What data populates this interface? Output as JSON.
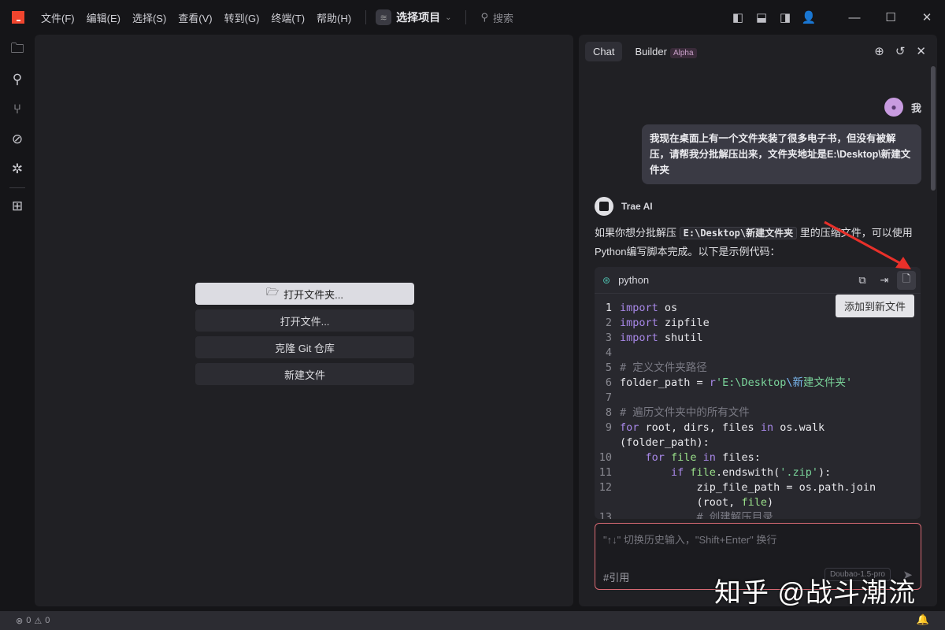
{
  "menu": [
    "文件(F)",
    "编辑(E)",
    "选择(S)",
    "查看(V)",
    "转到(G)",
    "终端(T)",
    "帮助(H)"
  ],
  "project": "选择项目",
  "search_placeholder": "搜索",
  "editor_buttons": {
    "open_folder": "打开文件夹...",
    "open_file": "打开文件...",
    "clone": "克隆 Git 仓库",
    "new_file": "新建文件"
  },
  "chat": {
    "tabs": {
      "chat": "Chat",
      "builder": "Builder",
      "alpha": "Alpha"
    },
    "user_name": "我",
    "user_message": "我现在桌面上有一个文件夹装了很多电子书，但没有被解压，请帮我分批解压出来，文件夹地址是E:\\Desktop\\新建文件夹",
    "ai_name": "Trae AI",
    "ai_text_1": "如果你想分批解压",
    "ai_inline_code": "E:\\Desktop\\新建文件夹",
    "ai_text_2": "里的压缩文件，可以使用Python编写脚本完成。以下是示例代码：",
    "code_lang": "python",
    "tooltip": "添加到新文件",
    "code_lines": [
      {
        "n": "1",
        "t": [
          [
            "kw",
            "import"
          ],
          [
            "id",
            " os"
          ]
        ]
      },
      {
        "n": "2",
        "t": [
          [
            "kw",
            "import"
          ],
          [
            "id",
            " zipfile"
          ]
        ]
      },
      {
        "n": "3",
        "t": [
          [
            "kw",
            "import"
          ],
          [
            "id",
            " shutil"
          ]
        ]
      },
      {
        "n": "4",
        "t": []
      },
      {
        "n": "5",
        "t": [
          [
            "cm",
            "# 定义文件夹路径"
          ]
        ]
      },
      {
        "n": "6",
        "t": [
          [
            "id",
            "folder_path = "
          ],
          [
            "kw",
            "r"
          ],
          [
            "st",
            "'E:\\Desktop"
          ],
          [
            "esc",
            "\\新"
          ],
          [
            "st",
            "建文件夹'"
          ]
        ]
      },
      {
        "n": "7",
        "t": []
      },
      {
        "n": "8",
        "t": [
          [
            "cm",
            "# 遍历文件夹中的所有文件"
          ]
        ]
      },
      {
        "n": "9",
        "t": [
          [
            "kw",
            "for"
          ],
          [
            "id",
            " root, dirs, files "
          ],
          [
            "kw",
            "in"
          ],
          [
            "id",
            " os.walk"
          ]
        ]
      },
      {
        "n": "",
        "t": [
          [
            "id",
            "(folder_path):"
          ]
        ]
      },
      {
        "n": "10",
        "t": [
          [
            "id",
            "    "
          ],
          [
            "kw",
            "for"
          ],
          [
            "fn",
            " file"
          ],
          [
            "kw",
            " in"
          ],
          [
            "id",
            " files:"
          ]
        ]
      },
      {
        "n": "11",
        "t": [
          [
            "id",
            "        "
          ],
          [
            "kw",
            "if"
          ],
          [
            "fn",
            " file"
          ],
          [
            "id",
            ".endswith("
          ],
          [
            "st",
            "'.zip'"
          ],
          [
            "id",
            "):"
          ]
        ]
      },
      {
        "n": "12",
        "t": [
          [
            "id",
            "            zip_file_path = os.path.join"
          ]
        ]
      },
      {
        "n": "",
        "t": [
          [
            "id",
            "            (root, "
          ],
          [
            "fn",
            "file"
          ],
          [
            "id",
            ")"
          ]
        ]
      },
      {
        "n": "13",
        "t": [
          [
            "cm",
            "            # 创建解压目录"
          ]
        ]
      }
    ],
    "input_placeholder": "\"↑↓\" 切换历史输入，\"Shift+Enter\" 换行",
    "reference": "#引用",
    "model": "Doubao-1.5-pro"
  },
  "watermark": "知乎 @战斗潮流",
  "status": {
    "errors": "0",
    "warnings": "0"
  }
}
